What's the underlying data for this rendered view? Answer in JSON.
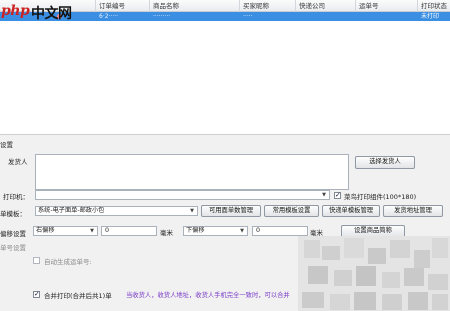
{
  "logo": {
    "brand": "php",
    "brand_cn": "中文网"
  },
  "grid": {
    "columns": [
      "订单编号",
      "商品名称",
      "买家昵称",
      "快递公司",
      "运单号",
      "打印状态"
    ],
    "selected_row": {
      "order_no": "6·2·····",
      "product": "·········",
      "buyer": "·····",
      "courier": "",
      "waybill": "",
      "status": "未打印"
    }
  },
  "settings": {
    "section_title": "设置",
    "sender": {
      "label": "发货人",
      "value": "",
      "button": "选择发货人"
    },
    "printer": {
      "label": "打印机：",
      "value": "",
      "cainiao_checkbox": true,
      "cainiao_label": "菜鸟打印组件(100*180)"
    },
    "template": {
      "label": "单模板：",
      "value": "系统-电子面单-邮政小包",
      "buttons": [
        "可用面单数管理",
        "常用模板设置",
        "快递单模板管理",
        "发货地址管理"
      ]
    },
    "offset": {
      "label": "偏移设置",
      "horizontal": {
        "direction": "右偏移",
        "value": "0",
        "unit": "毫米"
      },
      "vertical": {
        "direction": "下偏移",
        "value": "0",
        "unit": "毫米"
      },
      "button": "设置商品简称"
    },
    "order_no_section": "单号设置",
    "auto_waybill": {
      "checked": false,
      "label": "自动生成运单号:"
    },
    "merge_print": {
      "checked": true,
      "label": "合并打印(合并后共1)单"
    },
    "note": "当收货人，收货人地址，收货人手机完全一致时，可以合并"
  },
  "colors": {
    "selection": "#3b8fe3",
    "accent_note": "#7a3cc9",
    "panel_bg": "#f1f1f1"
  }
}
